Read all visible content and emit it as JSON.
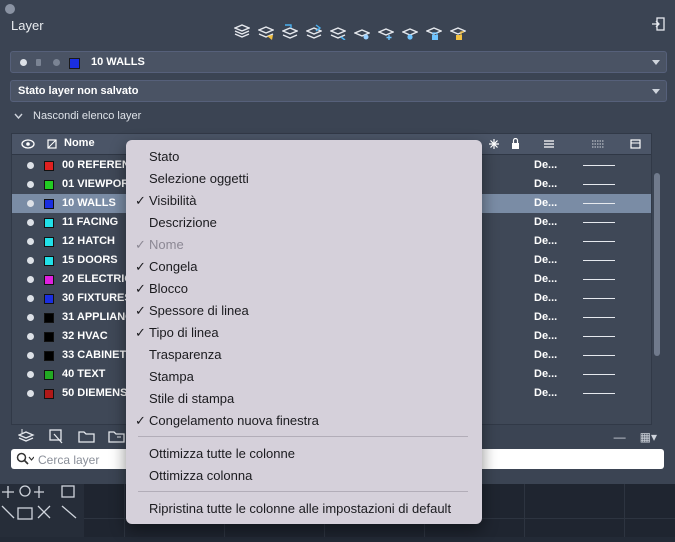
{
  "panel": {
    "title": "Layer",
    "current_layer": {
      "name": "10 WALLS",
      "color": "#1a2ee0"
    },
    "state_dropdown": "Stato layer non salvato",
    "hide_list_label": "Nascondi elenco layer"
  },
  "grid": {
    "headers": {
      "name": "Nome"
    },
    "rows": [
      {
        "name": "00 REFEREN",
        "color": "#e02020",
        "linetype": "De...",
        "selected": false
      },
      {
        "name": "01 VIEWPOR",
        "color": "#22cc22",
        "linetype": "De...",
        "selected": false
      },
      {
        "name": "10 WALLS",
        "color": "#1a2ee0",
        "linetype": "De...",
        "selected": true
      },
      {
        "name": "11 FACING",
        "color": "#22e0e8",
        "linetype": "De...",
        "selected": false
      },
      {
        "name": "12 HATCH",
        "color": "#22e0e8",
        "linetype": "De...",
        "selected": false
      },
      {
        "name": "15 DOORS",
        "color": "#22e0e8",
        "linetype": "De...",
        "selected": false
      },
      {
        "name": "20 ELECTRIC",
        "color": "#e020e0",
        "linetype": "De...",
        "selected": false
      },
      {
        "name": "30 FIXTURES",
        "color": "#1a2ee0",
        "linetype": "De...",
        "selected": false
      },
      {
        "name": "31 APPLIANC",
        "color": "#000000",
        "linetype": "De...",
        "selected": false
      },
      {
        "name": "32 HVAC",
        "color": "#000000",
        "linetype": "De...",
        "selected": false
      },
      {
        "name": "33 CABINET",
        "color": "#000000",
        "linetype": "De...",
        "selected": false
      },
      {
        "name": "40 TEXT",
        "color": "#22aa22",
        "linetype": "De...",
        "selected": false
      },
      {
        "name": "50 DIEMENS",
        "color": "#b01818",
        "linetype": "De...",
        "selected": false
      }
    ]
  },
  "search": {
    "placeholder": "Cerca layer"
  },
  "context_menu": {
    "items": [
      {
        "label": "Stato",
        "checked": false,
        "disabled": false
      },
      {
        "label": "Selezione oggetti",
        "checked": false,
        "disabled": false
      },
      {
        "label": "Visibilità",
        "checked": true,
        "disabled": false
      },
      {
        "label": "Descrizione",
        "checked": false,
        "disabled": false
      },
      {
        "label": "Nome",
        "checked": true,
        "disabled": true
      },
      {
        "label": "Congela",
        "checked": true,
        "disabled": false
      },
      {
        "label": "Blocco",
        "checked": true,
        "disabled": false
      },
      {
        "label": "Spessore di linea",
        "checked": true,
        "disabled": false
      },
      {
        "label": "Tipo di linea",
        "checked": true,
        "disabled": false
      },
      {
        "label": "Trasparenza",
        "checked": false,
        "disabled": false
      },
      {
        "label": "Stampa",
        "checked": false,
        "disabled": false
      },
      {
        "label": "Stile di stampa",
        "checked": false,
        "disabled": false
      },
      {
        "label": "Congelamento nuova finestra",
        "checked": true,
        "disabled": false
      }
    ],
    "optimize_all": "Ottimizza tutte le colonne",
    "optimize_one": "Ottimizza colonna",
    "reset": "Ripristina tutte le colonne alle impostazioni di default"
  }
}
